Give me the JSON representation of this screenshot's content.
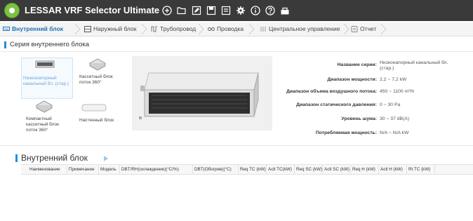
{
  "app": {
    "title": "LESSAR VRF Selector Ultimate",
    "accent": "#1e8fd6",
    "titlebar_color": "#3a3a3a",
    "toolbar_icons": [
      "add-icon",
      "folder-open-icon",
      "edit-icon",
      "save-icon",
      "save-as-icon",
      "settings-gear-icon",
      "info-icon",
      "help-icon",
      "export-icon"
    ]
  },
  "nav": {
    "steps": [
      {
        "label": "Внутренний блок",
        "icon": "indoor-unit-icon",
        "active": true
      },
      {
        "label": "Наружный блок",
        "icon": "outdoor-unit-icon",
        "active": false
      },
      {
        "label": "Трубопровод",
        "icon": "piping-icon",
        "active": false
      },
      {
        "label": "Проводка",
        "icon": "wiring-icon",
        "active": false
      },
      {
        "label": "Центральное управление",
        "icon": "central-control-icon",
        "active": false
      },
      {
        "label": "Отчет",
        "icon": "report-icon",
        "active": false
      }
    ]
  },
  "series_section": {
    "title": "Серия внутреннего блока",
    "units": [
      {
        "label": "Низконапорный канальный бл. (стар.)",
        "selected": true
      },
      {
        "label": "Кассетный блок поток 360°",
        "selected": false
      },
      {
        "label": "Компактный кассетный блок поток 360°",
        "selected": false
      },
      {
        "label": "Настенный блок",
        "selected": false
      }
    ]
  },
  "specs": [
    {
      "key": "Название серии:",
      "value": "Низконапорный канальный бл.(стар.)"
    },
    {
      "key": "Диапазон мощности:",
      "value": "2,2 ~ 7,2 kW"
    },
    {
      "key": "Диапазон объема воздушного потока:",
      "value": "450 ~ 1100 m³/h"
    },
    {
      "key": "Диапазон статического давления:",
      "value": "0 ~ 30 Pa"
    },
    {
      "key": "Уровень шума:",
      "value": "30 ~ 37 dB(A)"
    },
    {
      "key": "Потребляемая мощность:",
      "value": "N/A ~ N/A kW"
    }
  ],
  "indoor_table": {
    "title": "Внутренний блок",
    "columns": [
      "Наименование",
      "Примечание",
      "Модель",
      "DBT/RH(охлаждение)(°C/%)",
      "DBT(Обогрев)(°C)",
      "Req TC (kW)",
      "Actl TC(kW)",
      "Req SC (kW)",
      "Actl SC (kW)",
      "Req H (kW)",
      "Actl H (kW)",
      "Rt TC (kW)"
    ]
  }
}
